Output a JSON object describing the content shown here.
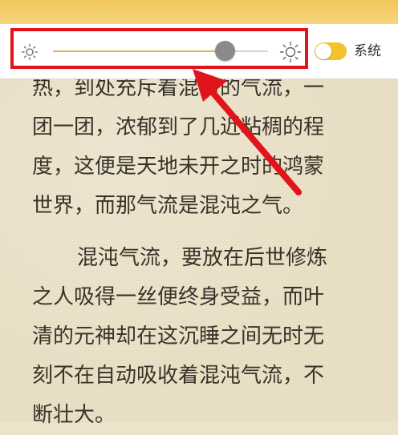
{
  "brightness": {
    "level": 0.8,
    "system_label": "系统",
    "system_enabled": true,
    "accent_color": "#e0b54b",
    "highlight_color": "#e1141c",
    "icons": [
      "brightness-low-icon",
      "brightness-high-icon"
    ]
  },
  "book": {
    "paragraphs": [
      {
        "lines": [
          "热，到处充斥着混淆的气流，一",
          "团一团，浓郁到了几近粘稠的程",
          "度，这便是天地未开之时的鸿蒙",
          "世界，而那气流是混沌之气。"
        ]
      },
      {
        "lines": [
          "混沌气流，要放在后世修炼",
          "之人吸得一丝便终身受益，而叶",
          "清的元神却在这沉睡之间无时无",
          "刻不在自动吸收着混沌气流，不",
          "断壮大。"
        ]
      }
    ]
  }
}
